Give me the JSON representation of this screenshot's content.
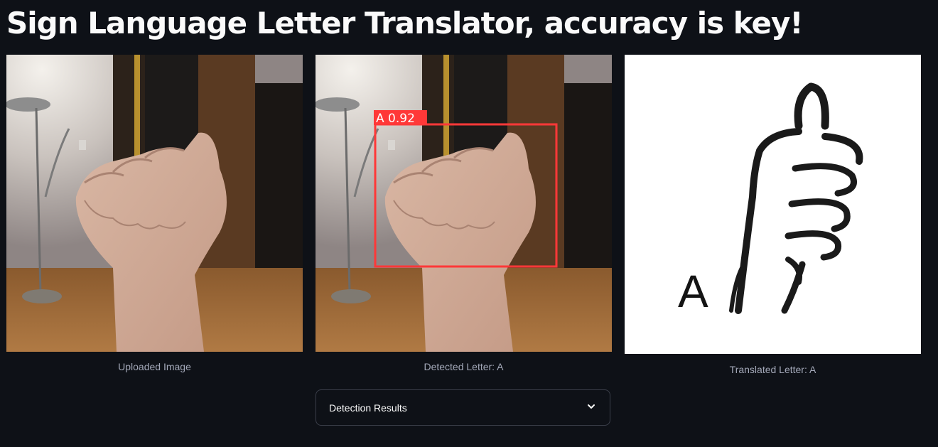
{
  "page": {
    "title": "Sign Language Letter Translator, accuracy is key!"
  },
  "images": {
    "uploaded_caption": "Uploaded Image",
    "detected_caption": "Detected Letter: A",
    "translated_caption": "Translated Letter: A"
  },
  "detection": {
    "box_label": "A 0.92",
    "box_color": "#ff3838"
  },
  "sign_card": {
    "letter": "A"
  },
  "expander": {
    "label": "Detection Results",
    "icon": "chevron-down-icon"
  },
  "colors": {
    "background": "#0e1117",
    "caption": "#a3a8b8",
    "border": "#3b3f4a"
  }
}
